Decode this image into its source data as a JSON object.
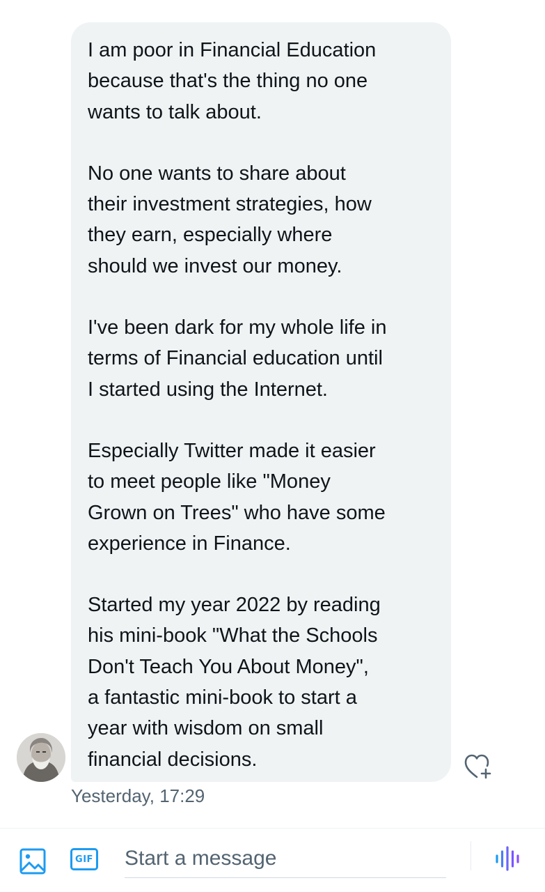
{
  "conversation": {
    "message": {
      "paragraphs": [
        "I am poor in Financial Education\nbecause that's the thing no one\nwants to talk about.",
        "No one wants to share about\ntheir investment strategies, how\nthey earn, especially where\nshould we invest our money.",
        "I've been dark for my whole life in\nterms of Financial education until\nI started using the Internet.",
        "Especially Twitter made it easier\nto meet people like \"Money\nGrown on Trees\" who have some\nexperience in Finance.",
        "Started my year 2022 by reading\nhis mini-book \"What the Schools\nDon't Teach You About Money\",\na fantastic mini-book to start a\nyear with wisdom on small\nfinancial decisions."
      ],
      "timestamp": "Yesterday, 17:29"
    }
  },
  "composer": {
    "placeholder": "Start a message",
    "gif_label": "GIF",
    "icons": {
      "media": "image-icon",
      "gif": "gif-icon",
      "voice": "voice-message-icon",
      "react": "heart-plus-icon"
    }
  },
  "colors": {
    "accent": "#1d9bf0",
    "voice_accent": "#7856ff",
    "bubble": "#eff3f4",
    "text": "#0f1419",
    "secondary_text": "#536471"
  }
}
